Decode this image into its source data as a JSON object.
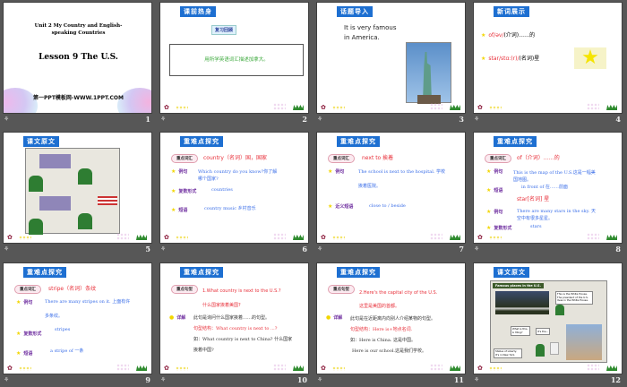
{
  "colors": {
    "background": "#575757",
    "badge": "#1d6fd1",
    "red": "#e8303a",
    "blue": "#3a6ee8",
    "purple": "#7030a0"
  },
  "footer_icon": "slide-notes-icon",
  "slides": [
    {
      "number": "1",
      "unit": "Unit 2 My Country and English-speaking Countries",
      "title": "Lesson 9 The U.S.",
      "site": "第一PPT模板网-WWW.1PPT.COM"
    },
    {
      "number": "2",
      "badge": "课前热身",
      "sub": "复习回顾",
      "task": "用所学英语词汇描述加拿大。"
    },
    {
      "number": "3",
      "badge": "话题导入",
      "line1": "It is very famous",
      "line2": "in America."
    },
    {
      "number": "4",
      "badge": "新词展示",
      "word1_red": "of/əv/",
      "word1_rest": "(介词)……的",
      "word2_red": "star/stɑː(r)/",
      "word2_rest": "(名词)星"
    },
    {
      "number": "5",
      "badge": "课文原文"
    },
    {
      "number": "6",
      "badge": "重难点探究",
      "tag": "重点词汇",
      "head": "country（名词）国，国家",
      "l1": "例句",
      "t1a": "Which country do you know?你了解",
      "t1b": "哪个国家?",
      "l2": "复数形式",
      "t2": "countries",
      "l3": "短语",
      "t3": "country music 乡村音乐"
    },
    {
      "number": "7",
      "badge": "重难点探究",
      "tag": "重点词汇",
      "head": "next to 挨着",
      "l1": "例句",
      "t1a": "The school is next to the hospital. 学校",
      "t1b": "挨着医院。",
      "l2": "近义短语",
      "t2": "close to / beside"
    },
    {
      "number": "8",
      "badge": "重难点探究",
      "tag": "重点词汇",
      "head": "of（介词）……的",
      "l1": "例句",
      "t1a": "This is the map of the U.S.这是一幅美",
      "t1b": "国地图。",
      "l2": "短语",
      "t2": "in front of 在……前面",
      "head2": "star[名词] 星",
      "l3": "例句",
      "t3a": "There are many stars in the sky. 天",
      "t3b": "空中有很多星星。",
      "l4": "复数形式",
      "t4": "stars"
    },
    {
      "number": "9",
      "badge": "重难点探究",
      "tag": "重点词汇",
      "head": "stripe（名词）条纹",
      "l1": "例句",
      "t1a": "There are many stripes on it. 上面有许",
      "t1b": "多条纹。",
      "l2": "复数形式",
      "t2": "stripes",
      "l3": "短语",
      "t3": "a stripe of 一条"
    },
    {
      "number": "10",
      "badge": "重难点探究",
      "tag": "重点句型",
      "head": "1.What country is next to the U.S.?",
      "head_cn": "什么国家挨着美国?",
      "l1": "详解",
      "t1": "此句是询问什么国家挨着……的句型。",
      "t2": "句型结构：What country is next to ...?",
      "t3a": "如：What country is next to China? 什么国家",
      "t3b": "挨着中国?"
    },
    {
      "number": "11",
      "badge": "重难点探究",
      "tag": "重点句型",
      "head": "2.Here's the capital city of the U.S.",
      "head_cn": "这里是美国的首都。",
      "l1": "详解",
      "t1": "此句是在近距离内向别人介绍某物的句型。",
      "t2": "句型结构：Here is+地点名词.",
      "t3": "如：Here is China. 这是中国。",
      "t4": "Here is our school.这是我们学校。"
    },
    {
      "number": "12",
      "badge": "课文原文",
      "img_title": "Famous places in the U.S.",
      "b1": "This is the White House. The president of the U.S. lives in the White House.",
      "b2": "What is this, Li Ming?",
      "b3": "It's the...",
      "b4": "Statue of Liberty. It's in New York."
    }
  ]
}
